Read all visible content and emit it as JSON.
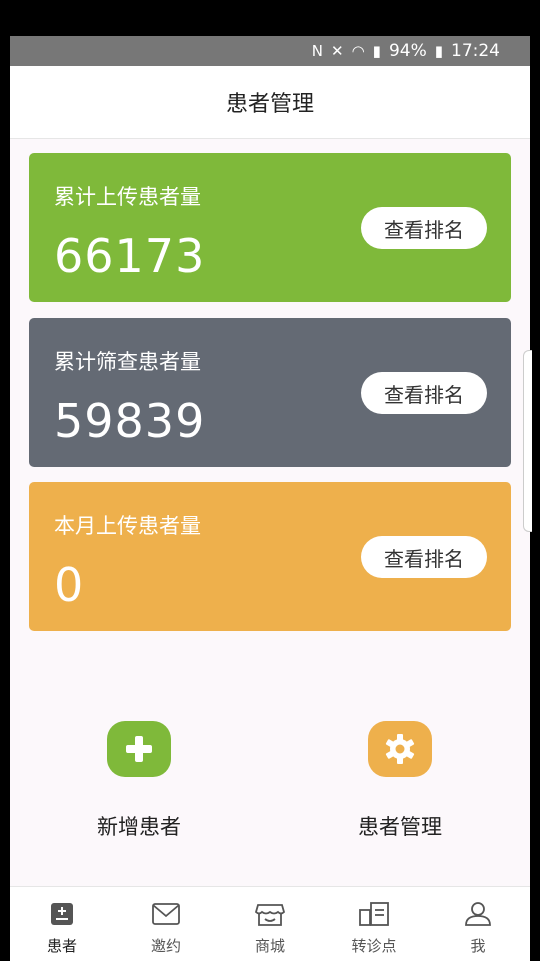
{
  "status_bar": {
    "nfc_icon": "nfc-icon",
    "mute_icon": "mute-icon",
    "wifi_icon": "wifi-icon",
    "signal_icon": "signal-icon",
    "battery_percent": "94%",
    "battery_icon": "battery-icon",
    "time": "17:24"
  },
  "header": {
    "title": "患者管理"
  },
  "cards": [
    {
      "label": "累计上传患者量",
      "value": "66173",
      "button": "查看排名",
      "color": "#7fb93a"
    },
    {
      "label": "累计筛查患者量",
      "value": "59839",
      "button": "查看排名",
      "color": "#646a74"
    },
    {
      "label": "本月上传患者量",
      "value": "0",
      "button": "查看排名",
      "color": "#eeb04c"
    }
  ],
  "actions": {
    "add": {
      "label": "新增患者",
      "icon": "plus-icon"
    },
    "manage": {
      "label": "患者管理",
      "icon": "gear-icon"
    }
  },
  "tabs": [
    {
      "label": "患者",
      "icon": "patient-icon",
      "active": true
    },
    {
      "label": "邀约",
      "icon": "mail-icon",
      "active": false
    },
    {
      "label": "商城",
      "icon": "store-icon",
      "active": false
    },
    {
      "label": "转诊点",
      "icon": "referral-icon",
      "active": false
    },
    {
      "label": "我",
      "icon": "user-icon",
      "active": false
    }
  ]
}
